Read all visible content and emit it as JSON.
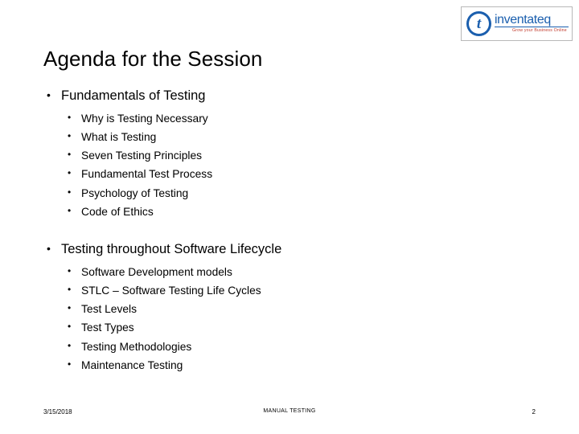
{
  "logo": {
    "glyph": "t",
    "wordmark": "inventateq",
    "tagline": "Grow your Business Online",
    "name": "inventateq-logo"
  },
  "title": "Agenda for the Session",
  "bullet_char": "•",
  "sections": [
    {
      "heading": "Fundamentals of Testing",
      "items": [
        "Why is Testing Necessary",
        "What is Testing",
        "Seven Testing Principles",
        "Fundamental Test Process",
        "Psychology of Testing",
        "Code of Ethics"
      ]
    },
    {
      "heading": "Testing throughout Software Lifecycle",
      "items": [
        "Software Development models",
        "STLC – Software Testing Life Cycles",
        "Test Levels",
        "Test Types",
        "Testing Methodologies",
        "Maintenance Testing"
      ]
    }
  ],
  "footer": {
    "date": "3/15/2018",
    "center": "MANUAL TESTING",
    "page": "2"
  }
}
